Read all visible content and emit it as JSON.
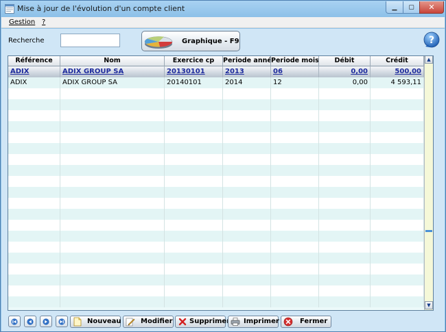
{
  "window": {
    "title": "Mise à jour de l'évolution d'un compte client",
    "min_glyph": "▁",
    "max_glyph": "▢",
    "close_glyph": "✕"
  },
  "menu": {
    "items": [
      {
        "label": "Gestion"
      },
      {
        "label": "?"
      }
    ]
  },
  "search": {
    "label": "Recherche",
    "value": "",
    "placeholder": ""
  },
  "graph_button": {
    "label": "Graphique - F9",
    "icon": "pie-chart-icon"
  },
  "help": {
    "icon": "help-icon",
    "glyph": "?"
  },
  "table": {
    "columns": [
      {
        "label": "Référence"
      },
      {
        "label": "Nom"
      },
      {
        "label": "Exercice cp"
      },
      {
        "label": "Periode année"
      },
      {
        "label": "Periode mois"
      },
      {
        "label": "Débit"
      },
      {
        "label": "Crédit"
      }
    ],
    "rows": [
      {
        "reference": "ADIX",
        "nom": "ADIX GROUP SA",
        "exercice": "20130101",
        "annee": "2013",
        "mois": "06",
        "debit": "0,00",
        "credit": "500,00",
        "selected": true
      },
      {
        "reference": "ADIX",
        "nom": "ADIX GROUP SA",
        "exercice": "20140101",
        "annee": "2014",
        "mois": "12",
        "debit": "0,00",
        "credit": "4 593,11",
        "selected": false
      }
    ],
    "column_picker_icon": "column-picker-icon",
    "scroll_up_glyph": "▲",
    "scroll_down_glyph": "▼"
  },
  "toolbar": {
    "nav": [
      {
        "name": "first-record-button",
        "icon": "first-icon"
      },
      {
        "name": "previous-record-button",
        "icon": "previous-icon"
      },
      {
        "name": "next-record-button",
        "icon": "next-icon"
      },
      {
        "name": "last-record-button",
        "icon": "last-icon"
      }
    ],
    "nouveau_label": "Nouveau",
    "modifier_label": "Modifier",
    "supprimer_label": "Supprimer",
    "imprimer_label": "Imprimer",
    "fermer_label": "Fermer"
  },
  "colors": {
    "window_frame": "#8ec2e8",
    "client_background": "#d0e6f6",
    "selected_row_text": "#1d2a9c",
    "grid_alt_row": "#e3f5f5",
    "close_button": "#c8453a"
  }
}
